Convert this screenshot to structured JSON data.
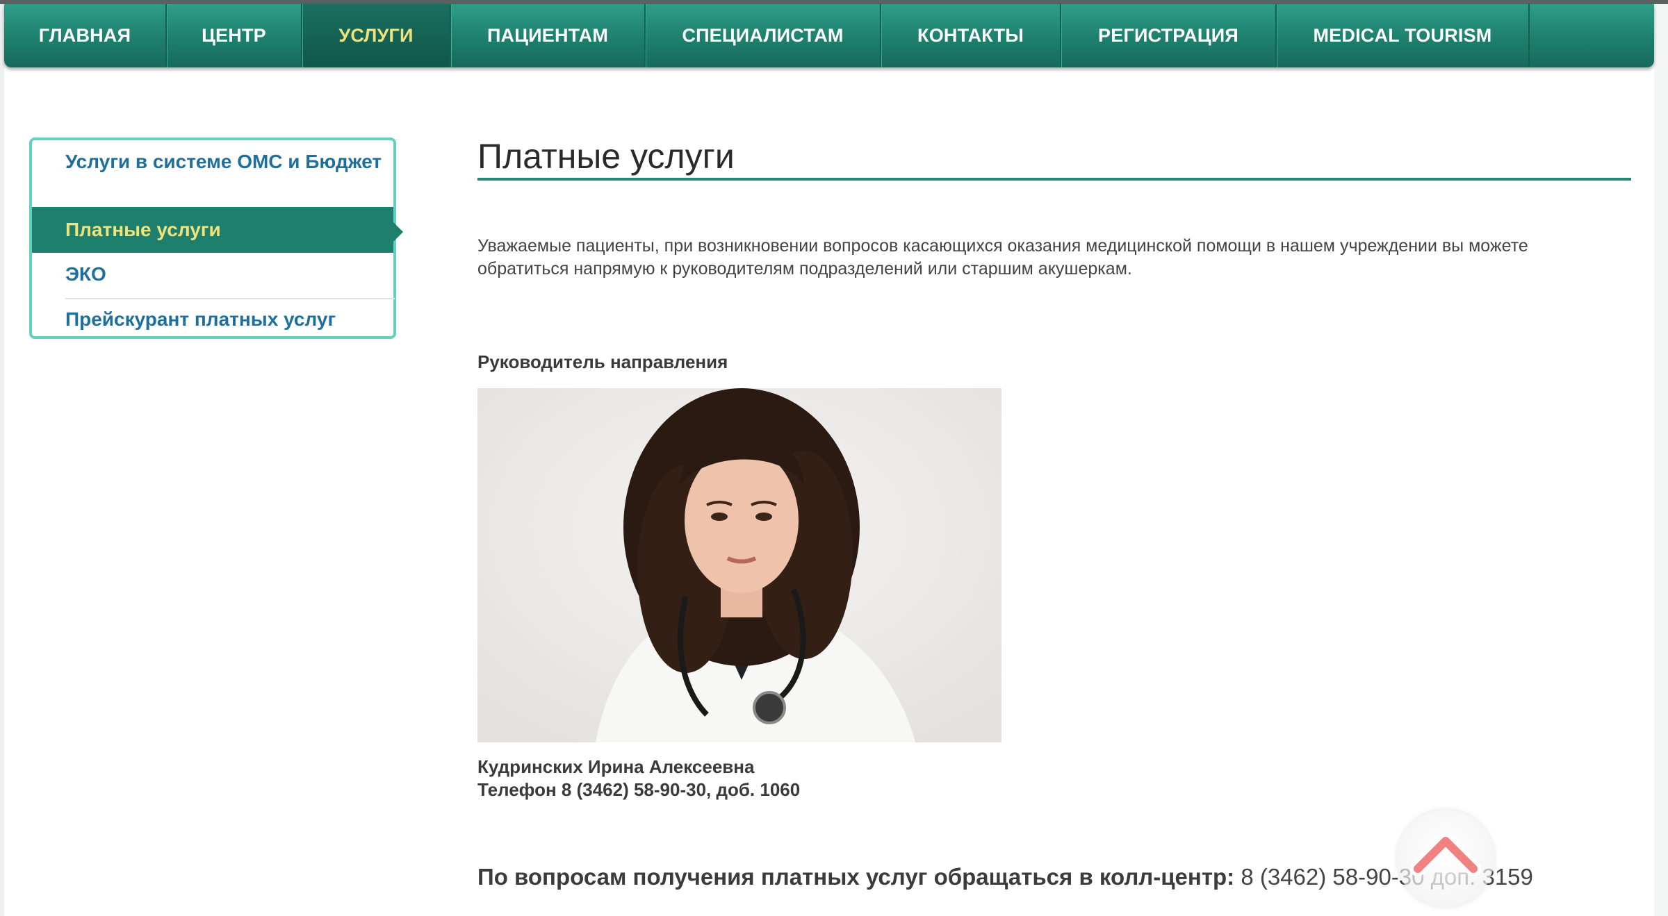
{
  "nav": {
    "items": [
      {
        "label": "ГЛАВНАЯ"
      },
      {
        "label": "ЦЕНТР"
      },
      {
        "label": "УСЛУГИ"
      },
      {
        "label": "ПАЦИЕНТАМ"
      },
      {
        "label": "СПЕЦИАЛИСТАМ"
      },
      {
        "label": "КОНТАКТЫ"
      },
      {
        "label": "РЕГИСТРАЦИЯ"
      },
      {
        "label": "MEDICAL TOURISM"
      }
    ],
    "active_index": 2
  },
  "sidebar": {
    "items": [
      {
        "label": "Услуги в системе ОМС и Бюджет"
      },
      {
        "label": "Платные услуги"
      },
      {
        "label": "ЭКО"
      },
      {
        "label": "Прейскурант платных услуг"
      }
    ],
    "active_index": 1
  },
  "main": {
    "title": "Платные услуги",
    "intro": "Уважаемые пациенты, при возникновении вопросов касающихся оказания медицинской помощи в нашем учреждении вы можете обратиться напрямую к руководителям подразделений или старшим акушеркам.",
    "section_heading": "Руководитель направления",
    "person": {
      "name": "Кудринских Ирина Алексеевна",
      "phone": "Телефон 8 (3462) 58-90-30, доб. 1060"
    },
    "callcenter": {
      "label": "По вопросам получения платных услуг обращаться в колл-центр:",
      "phone": "8 (3462) 58-90-30 доп. 3159"
    }
  },
  "icons": {
    "scroll_top": "chevron-up-icon"
  },
  "colors": {
    "brand_green": "#1e7f6d",
    "active_text": "#f1e27a",
    "link_blue": "#1f6f9c",
    "sidebar_border": "#62d2bf"
  }
}
